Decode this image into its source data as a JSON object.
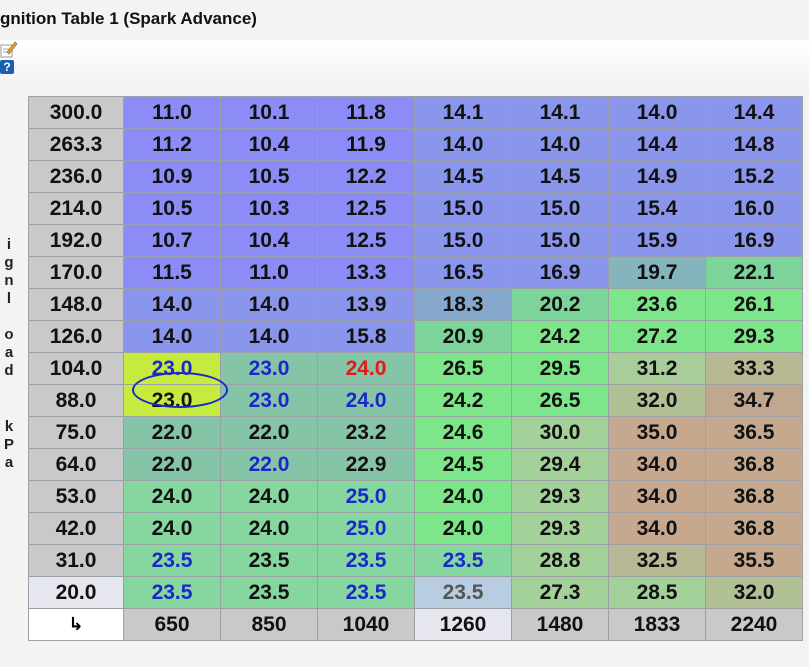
{
  "window": {
    "title": "gnition Table 1 (Spark Advance)"
  },
  "side_axis_letters": [
    "i",
    "g",
    "n",
    "l",
    "o",
    "a",
    "d",
    "k",
    "P",
    "a"
  ],
  "rows": [
    {
      "label": "300.0",
      "cells": [
        {
          "v": "11.0",
          "bg": "#8c8cf6",
          "fg": "#111"
        },
        {
          "v": "10.1",
          "bg": "#8c8cf6",
          "fg": "#111"
        },
        {
          "v": "11.8",
          "bg": "#8c8cf6",
          "fg": "#111"
        },
        {
          "v": "14.1",
          "bg": "#8a96ec",
          "fg": "#111"
        },
        {
          "v": "14.1",
          "bg": "#8a96ec",
          "fg": "#111"
        },
        {
          "v": "14.0",
          "bg": "#8a96ec",
          "fg": "#111"
        },
        {
          "v": "14.4",
          "bg": "#8a96ec",
          "fg": "#111"
        }
      ]
    },
    {
      "label": "263.3",
      "cells": [
        {
          "v": "11.2",
          "bg": "#8c8cf6",
          "fg": "#111"
        },
        {
          "v": "10.4",
          "bg": "#8c8cf6",
          "fg": "#111"
        },
        {
          "v": "11.9",
          "bg": "#8c8cf6",
          "fg": "#111"
        },
        {
          "v": "14.0",
          "bg": "#8a96ec",
          "fg": "#111"
        },
        {
          "v": "14.0",
          "bg": "#8a96ec",
          "fg": "#111"
        },
        {
          "v": "14.4",
          "bg": "#8a96ec",
          "fg": "#111"
        },
        {
          "v": "14.8",
          "bg": "#8a96ec",
          "fg": "#111"
        }
      ]
    },
    {
      "label": "236.0",
      "cells": [
        {
          "v": "10.9",
          "bg": "#8c8cf6",
          "fg": "#111"
        },
        {
          "v": "10.5",
          "bg": "#8c8cf6",
          "fg": "#111"
        },
        {
          "v": "12.2",
          "bg": "#8c8cf6",
          "fg": "#111"
        },
        {
          "v": "14.5",
          "bg": "#8a96ec",
          "fg": "#111"
        },
        {
          "v": "14.5",
          "bg": "#8a96ec",
          "fg": "#111"
        },
        {
          "v": "14.9",
          "bg": "#8a96ec",
          "fg": "#111"
        },
        {
          "v": "15.2",
          "bg": "#8a96ec",
          "fg": "#111"
        }
      ]
    },
    {
      "label": "214.0",
      "cells": [
        {
          "v": "10.5",
          "bg": "#8c8cf6",
          "fg": "#111"
        },
        {
          "v": "10.3",
          "bg": "#8c8cf6",
          "fg": "#111"
        },
        {
          "v": "12.5",
          "bg": "#8c8cf6",
          "fg": "#111"
        },
        {
          "v": "15.0",
          "bg": "#8a96ec",
          "fg": "#111"
        },
        {
          "v": "15.0",
          "bg": "#8a96ec",
          "fg": "#111"
        },
        {
          "v": "15.4",
          "bg": "#8a96ec",
          "fg": "#111"
        },
        {
          "v": "16.0",
          "bg": "#8a96ec",
          "fg": "#111"
        }
      ]
    },
    {
      "label": "192.0",
      "cells": [
        {
          "v": "10.7",
          "bg": "#8c8cf6",
          "fg": "#111"
        },
        {
          "v": "10.4",
          "bg": "#8c8cf6",
          "fg": "#111"
        },
        {
          "v": "12.5",
          "bg": "#8c8cf6",
          "fg": "#111"
        },
        {
          "v": "15.0",
          "bg": "#8a96ec",
          "fg": "#111"
        },
        {
          "v": "15.0",
          "bg": "#8a96ec",
          "fg": "#111"
        },
        {
          "v": "15.9",
          "bg": "#8a96ec",
          "fg": "#111"
        },
        {
          "v": "16.9",
          "bg": "#8a96ec",
          "fg": "#111"
        }
      ]
    },
    {
      "label": "170.0",
      "cells": [
        {
          "v": "11.5",
          "bg": "#8c8cf6",
          "fg": "#111"
        },
        {
          "v": "11.0",
          "bg": "#8c8cf6",
          "fg": "#111"
        },
        {
          "v": "13.3",
          "bg": "#8c8cf6",
          "fg": "#111"
        },
        {
          "v": "16.5",
          "bg": "#8a96ec",
          "fg": "#111"
        },
        {
          "v": "16.9",
          "bg": "#8a96ec",
          "fg": "#111"
        },
        {
          "v": "19.7",
          "bg": "#84b4bc",
          "fg": "#111"
        },
        {
          "v": "22.1",
          "bg": "#7cd49a",
          "fg": "#111"
        }
      ]
    },
    {
      "label": "148.0",
      "cells": [
        {
          "v": "14.0",
          "bg": "#8a96ec",
          "fg": "#111"
        },
        {
          "v": "14.0",
          "bg": "#8a96ec",
          "fg": "#111"
        },
        {
          "v": "13.9",
          "bg": "#8a96ec",
          "fg": "#111"
        },
        {
          "v": "18.3",
          "bg": "#86a8cc",
          "fg": "#111"
        },
        {
          "v": "20.2",
          "bg": "#7cd49a",
          "fg": "#111"
        },
        {
          "v": "23.6",
          "bg": "#7ee68a",
          "fg": "#111"
        },
        {
          "v": "26.1",
          "bg": "#7ee68a",
          "fg": "#111"
        }
      ]
    },
    {
      "label": "126.0",
      "cells": [
        {
          "v": "14.0",
          "bg": "#8a96ec",
          "fg": "#111"
        },
        {
          "v": "14.0",
          "bg": "#8a96ec",
          "fg": "#111"
        },
        {
          "v": "15.8",
          "bg": "#8a96ec",
          "fg": "#111"
        },
        {
          "v": "20.9",
          "bg": "#7cd49a",
          "fg": "#111"
        },
        {
          "v": "24.2",
          "bg": "#7ee68a",
          "fg": "#111"
        },
        {
          "v": "27.2",
          "bg": "#7ee68a",
          "fg": "#111"
        },
        {
          "v": "29.3",
          "bg": "#7ee68a",
          "fg": "#111"
        }
      ]
    },
    {
      "label": "104.0",
      "cells": [
        {
          "v": "23.0",
          "bg": "#c6ea3e",
          "fg": "#1b28c8",
          "selected": true
        },
        {
          "v": "23.0",
          "bg": "#86c4a8",
          "fg": "#1b28c8"
        },
        {
          "v": "24.0",
          "bg": "#86c4a8",
          "fg": "#e21a1a"
        },
        {
          "v": "26.5",
          "bg": "#7ee68a",
          "fg": "#111"
        },
        {
          "v": "29.5",
          "bg": "#7ee68a",
          "fg": "#111"
        },
        {
          "v": "31.2",
          "bg": "#a8cc9a",
          "fg": "#111"
        },
        {
          "v": "33.3",
          "bg": "#b8b894",
          "fg": "#111"
        }
      ]
    },
    {
      "label": "88.0",
      "cells": [
        {
          "v": "23.0",
          "bg": "#c6ea3e",
          "fg": "#111"
        },
        {
          "v": "23.0",
          "bg": "#86c4a8",
          "fg": "#1b28c8"
        },
        {
          "v": "24.0",
          "bg": "#86c4a8",
          "fg": "#1b28c8"
        },
        {
          "v": "24.2",
          "bg": "#7ee68a",
          "fg": "#111"
        },
        {
          "v": "26.5",
          "bg": "#7ee68a",
          "fg": "#111"
        },
        {
          "v": "32.0",
          "bg": "#b2c096",
          "fg": "#111"
        },
        {
          "v": "34.7",
          "bg": "#c0a890",
          "fg": "#111"
        }
      ]
    },
    {
      "label": "75.0",
      "cells": [
        {
          "v": "22.0",
          "bg": "#86c4a8",
          "fg": "#111"
        },
        {
          "v": "22.0",
          "bg": "#86c4a8",
          "fg": "#111"
        },
        {
          "v": "23.2",
          "bg": "#86c4a8",
          "fg": "#111"
        },
        {
          "v": "24.6",
          "bg": "#7ee68a",
          "fg": "#111"
        },
        {
          "v": "30.0",
          "bg": "#a4d09a",
          "fg": "#111"
        },
        {
          "v": "35.0",
          "bg": "#c6a88e",
          "fg": "#111"
        },
        {
          "v": "36.5",
          "bg": "#c6a88e",
          "fg": "#111"
        }
      ]
    },
    {
      "label": "64.0",
      "cells": [
        {
          "v": "22.0",
          "bg": "#86c4a8",
          "fg": "#111"
        },
        {
          "v": "22.0",
          "bg": "#86c4a8",
          "fg": "#1b28c8"
        },
        {
          "v": "22.9",
          "bg": "#86c4a8",
          "fg": "#111"
        },
        {
          "v": "24.5",
          "bg": "#7ee68a",
          "fg": "#111"
        },
        {
          "v": "29.4",
          "bg": "#a4d09a",
          "fg": "#111"
        },
        {
          "v": "34.0",
          "bg": "#c6a88e",
          "fg": "#111"
        },
        {
          "v": "36.8",
          "bg": "#c6a88e",
          "fg": "#111"
        }
      ]
    },
    {
      "label": "53.0",
      "cells": [
        {
          "v": "24.0",
          "bg": "#86d6a0",
          "fg": "#111"
        },
        {
          "v": "24.0",
          "bg": "#86d6a0",
          "fg": "#111"
        },
        {
          "v": "25.0",
          "bg": "#86d6a0",
          "fg": "#1b28c8"
        },
        {
          "v": "24.0",
          "bg": "#7ee68a",
          "fg": "#111"
        },
        {
          "v": "29.3",
          "bg": "#a4d09a",
          "fg": "#111"
        },
        {
          "v": "34.0",
          "bg": "#c6a88e",
          "fg": "#111"
        },
        {
          "v": "36.8",
          "bg": "#c6a88e",
          "fg": "#111"
        }
      ]
    },
    {
      "label": "42.0",
      "cells": [
        {
          "v": "24.0",
          "bg": "#86d6a0",
          "fg": "#111"
        },
        {
          "v": "24.0",
          "bg": "#86d6a0",
          "fg": "#111"
        },
        {
          "v": "25.0",
          "bg": "#86d6a0",
          "fg": "#1b28c8"
        },
        {
          "v": "24.0",
          "bg": "#7ee68a",
          "fg": "#111"
        },
        {
          "v": "29.3",
          "bg": "#a4d09a",
          "fg": "#111"
        },
        {
          "v": "34.0",
          "bg": "#c6a88e",
          "fg": "#111"
        },
        {
          "v": "36.8",
          "bg": "#c6a88e",
          "fg": "#111"
        }
      ]
    },
    {
      "label": "31.0",
      "cells": [
        {
          "v": "23.5",
          "bg": "#86d6a0",
          "fg": "#1b28c8"
        },
        {
          "v": "23.5",
          "bg": "#86d6a0",
          "fg": "#111"
        },
        {
          "v": "23.5",
          "bg": "#86d6a0",
          "fg": "#1b28c8"
        },
        {
          "v": "23.5",
          "bg": "#86d6a0",
          "fg": "#1b28c8"
        },
        {
          "v": "28.8",
          "bg": "#a4d09a",
          "fg": "#111"
        },
        {
          "v": "32.5",
          "bg": "#b8b894",
          "fg": "#111"
        },
        {
          "v": "35.5",
          "bg": "#c6a88e",
          "fg": "#111"
        }
      ]
    },
    {
      "label": "20.0",
      "cells": [
        {
          "v": "23.5",
          "bg": "#86d6a0",
          "fg": "#1b28c8"
        },
        {
          "v": "23.5",
          "bg": "#86d6a0",
          "fg": "#111"
        },
        {
          "v": "23.5",
          "bg": "#86d6a0",
          "fg": "#1b28c8"
        },
        {
          "v": "23.5",
          "bg": "#b8cce2",
          "fg": "#555"
        },
        {
          "v": "27.3",
          "bg": "#a4d09a",
          "fg": "#111"
        },
        {
          "v": "28.5",
          "bg": "#a4d09a",
          "fg": "#111"
        },
        {
          "v": "32.0",
          "bg": "#b2c096",
          "fg": "#111"
        }
      ]
    }
  ],
  "corner_glyph": "↳",
  "columns": [
    {
      "label": "650",
      "light": false
    },
    {
      "label": "850",
      "light": false
    },
    {
      "label": "1040",
      "light": false
    },
    {
      "label": "1260",
      "light": true
    },
    {
      "label": "1480",
      "light": false
    },
    {
      "label": "1833",
      "light": false
    },
    {
      "label": "2240",
      "light": false
    }
  ]
}
